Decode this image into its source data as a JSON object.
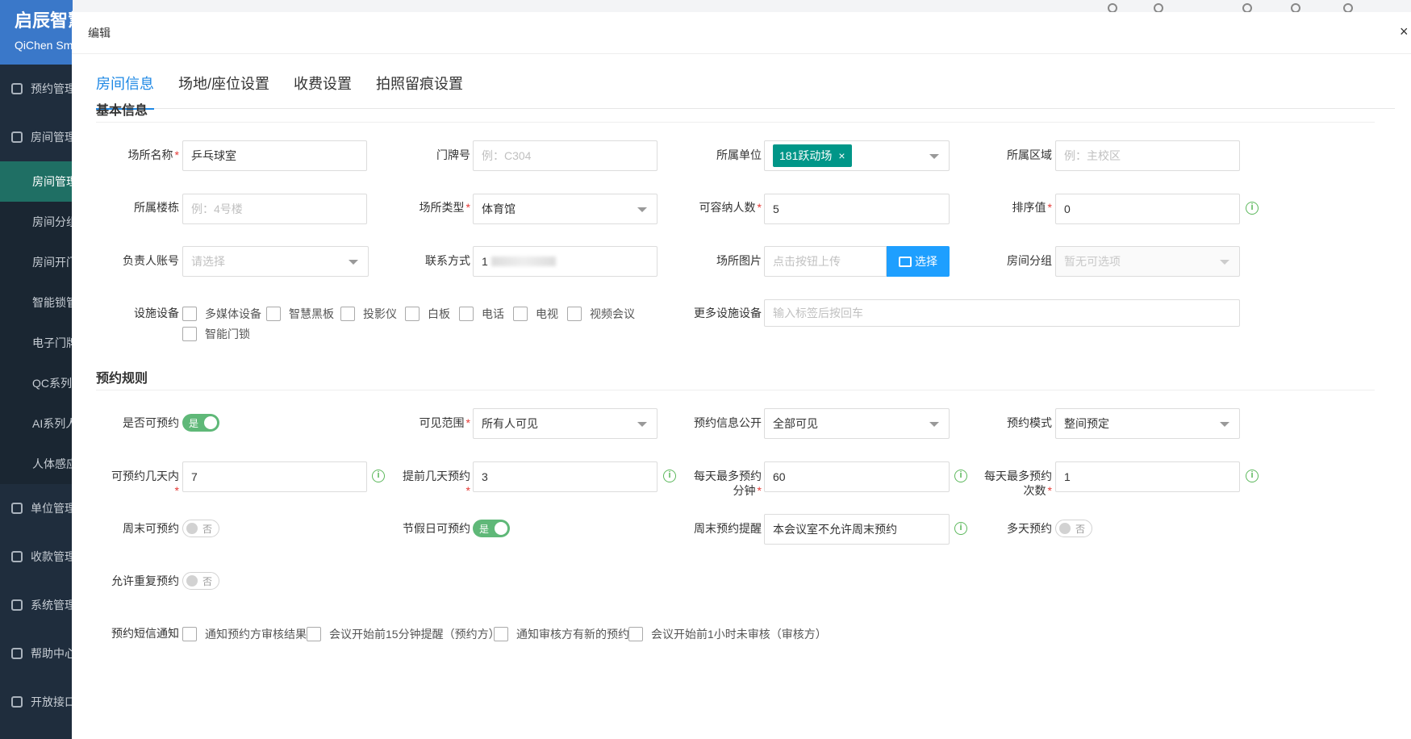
{
  "app": {
    "logo_title": "启辰智慧",
    "logo_subtitle": "QiChen Sm",
    "menu": [
      {
        "label": "预约管理"
      },
      {
        "label": "房间管理"
      }
    ],
    "submenu": [
      {
        "label": "房间管理"
      },
      {
        "label": "房间分组"
      },
      {
        "label": "房间开门"
      },
      {
        "label": "智能锁管"
      },
      {
        "label": "电子门牌"
      },
      {
        "label": "QC系列"
      },
      {
        "label": "AI系列人"
      },
      {
        "label": "人体感应"
      }
    ],
    "menu2": [
      {
        "label": "单位管理"
      },
      {
        "label": "收款管理"
      },
      {
        "label": "系统管理"
      },
      {
        "label": "帮助中心"
      },
      {
        "label": "开放接口"
      }
    ]
  },
  "dialog": {
    "title": "编辑",
    "close": "×",
    "tabs": [
      {
        "label": "房间信息"
      },
      {
        "label": "场地/座位设置"
      },
      {
        "label": "收费设置"
      },
      {
        "label": "拍照留痕设置"
      }
    ]
  },
  "basic": {
    "section_title": "基本信息",
    "venue_name": {
      "label": "场所名称",
      "value": "乒乓球室"
    },
    "door_no": {
      "label": "门牌号",
      "placeholder": "例：C304"
    },
    "unit": {
      "label": "所属单位",
      "tag": "181跃动场",
      "tag_close": "×"
    },
    "area": {
      "label": "所属区域",
      "placeholder": "例：主校区"
    },
    "building": {
      "label": "所属楼栋",
      "placeholder": "例：4号楼"
    },
    "venue_type": {
      "label": "场所类型",
      "value": "体育馆"
    },
    "capacity": {
      "label": "可容纳人数",
      "value": "5"
    },
    "sort": {
      "label": "排序值",
      "value": "0"
    },
    "owner": {
      "label": "负责人账号",
      "placeholder": "请选择"
    },
    "contact": {
      "label": "联系方式",
      "value": "1"
    },
    "picture": {
      "label": "场所图片",
      "placeholder": "点击按钮上传",
      "button": "选择"
    },
    "group": {
      "label": "房间分组",
      "placeholder": "暂无可选项"
    },
    "facilities": {
      "label": "设施设备",
      "options": [
        "多媒体设备",
        "智慧黑板",
        "投影仪",
        "白板",
        "电话",
        "电视",
        "视频会议",
        "智能门锁"
      ]
    },
    "more_facilities": {
      "label": "更多设施设备",
      "placeholder": "输入标签后按回车"
    }
  },
  "rules": {
    "section_title": "预约规则",
    "bookable": {
      "label": "是否可预约",
      "state": "是"
    },
    "visibility": {
      "label": "可见范围",
      "value": "所有人可见"
    },
    "info_public": {
      "label": "预约信息公开",
      "value": "全部可见"
    },
    "mode": {
      "label": "预约模式",
      "value": "整间预定"
    },
    "days_within": {
      "label": "可预约几天内",
      "value": "7"
    },
    "advance_days": {
      "label": "提前几天预约",
      "value": "3"
    },
    "max_minutes": {
      "label_line1": "每天最多预约",
      "label_line2": "分钟",
      "value": "60"
    },
    "max_times": {
      "label_line1": "每天最多预约",
      "label_line2": "次数",
      "value": "1"
    },
    "weekend": {
      "label": "周末可预约",
      "state": "否"
    },
    "holiday": {
      "label": "节假日可预约",
      "state": "是"
    },
    "weekend_reminder": {
      "label": "周末预约提醒",
      "value": "本会议室不允许周末预约"
    },
    "multi_day": {
      "label": "多天预约",
      "state": "否"
    },
    "repeat": {
      "label": "允许重复预约",
      "state": "否"
    },
    "sms": {
      "label": "预约短信通知",
      "options": [
        "通知预约方审核结果",
        "会议开始前15分钟提醒（预约方）",
        "通知审核方有新的预约",
        "会议开始前1小时未审核（审核方）"
      ]
    }
  },
  "colors": {
    "primary": "#1e88e5",
    "switch_on": "#5fb878",
    "tag": "#009688",
    "button": "#1e9fff"
  }
}
